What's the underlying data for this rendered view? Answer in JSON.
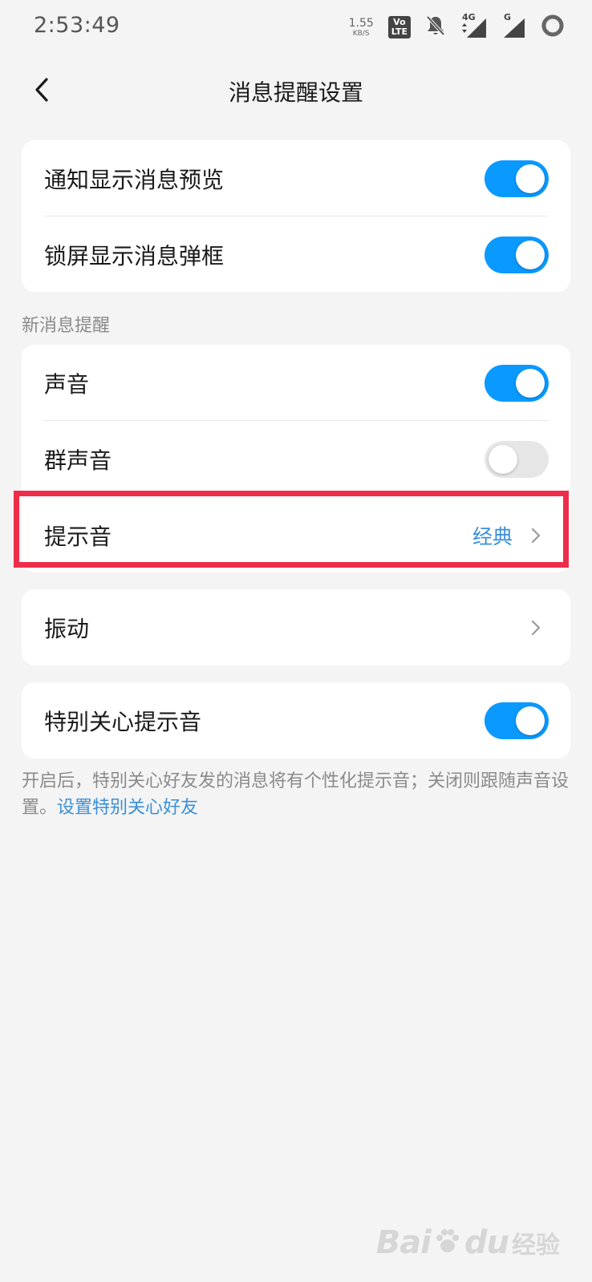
{
  "status_bar": {
    "time": "2:53:49",
    "net_speed_value": "1.55",
    "net_speed_unit": "KB/S",
    "volte_top": "Vo",
    "volte_bottom": "LTE",
    "signal_1_label": "4G",
    "signal_2_label": "G"
  },
  "nav": {
    "title": "消息提醒设置"
  },
  "card1": {
    "items": [
      {
        "label": "通知显示消息预览",
        "on": true
      },
      {
        "label": "锁屏显示消息弹框",
        "on": true
      }
    ]
  },
  "section": {
    "new_message_label": "新消息提醒"
  },
  "card2": {
    "items": [
      {
        "label": "声音",
        "on": true
      },
      {
        "label": "群声音",
        "on": false
      },
      {
        "label": "提示音",
        "value": "经典"
      }
    ]
  },
  "card3": {
    "label": "振动"
  },
  "card4": {
    "label": "特别关心提示音",
    "on": true
  },
  "footnote": {
    "text": "开启后，特别关心好友发的消息将有个性化提示音；关闭则跟随声音设置。",
    "link": "设置特别关心好友"
  },
  "watermark": {
    "brand": "Bai",
    "suffix": "du",
    "product": "经验"
  },
  "colors": {
    "accent": "#0a99ff",
    "link": "#3a8fd9",
    "highlight": "#ee2d4b",
    "background": "#f4f4f4"
  }
}
